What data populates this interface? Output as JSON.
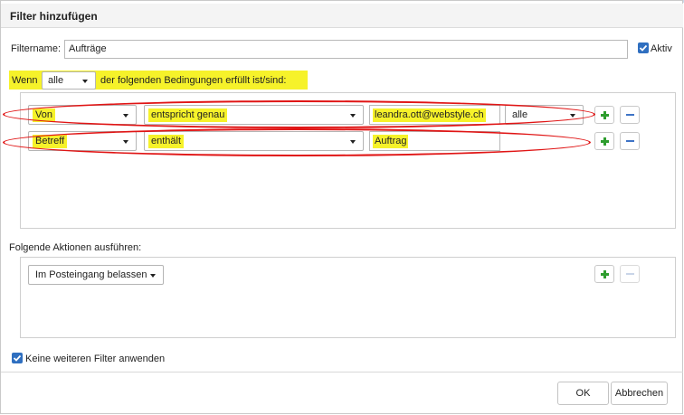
{
  "dialog": {
    "title": "Filter hinzufügen"
  },
  "filter": {
    "name_label": "Filtername:",
    "name_value": "Aufträge",
    "active_label": "Aktiv",
    "active_checked": true
  },
  "conditions": {
    "prefix": "Wenn",
    "mode_value": "alle",
    "suffix": "der folgenden Bedingungen erfüllt ist/sind:",
    "rows": [
      {
        "field": "Von",
        "operator": "entspricht genau",
        "value": "leandra.ott@webstyle.ch",
        "scope": "alle"
      },
      {
        "field": "Betreff",
        "operator": "enthält",
        "value": "Auftrag"
      }
    ]
  },
  "actions": {
    "heading": "Folgende Aktionen ausführen:",
    "rows": [
      {
        "action": "Im Posteingang belassen"
      }
    ]
  },
  "footer": {
    "stop_label": "Keine weiteren Filter anwenden",
    "stop_checked": true,
    "ok_label": "OK",
    "cancel_label": "Abbrechen"
  },
  "colors": {
    "highlight": "#f6f22a",
    "annotation_red": "#e01515",
    "checkbox_blue": "#2f6fc0",
    "add_green": "#2e9d2e",
    "remove_blue": "#3f74c6"
  },
  "icons": {
    "add": "plus-icon",
    "remove": "minus-icon",
    "dropdown": "chevron-down-icon",
    "check": "checkmark-icon"
  }
}
